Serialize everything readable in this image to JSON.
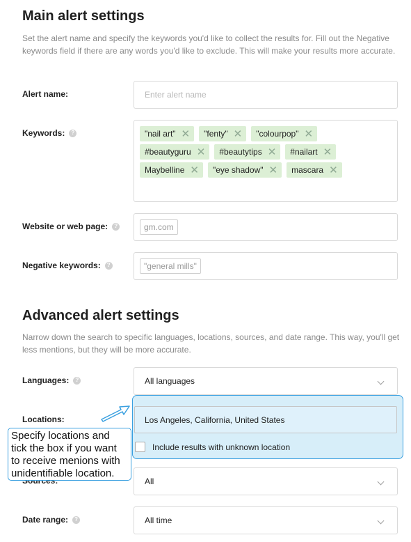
{
  "main": {
    "title": "Main alert settings",
    "description": "Set the alert name and specify the keywords you'd like to collect the results for. Fill out the Negative keywords field if there are any words you'd like to exclude. This will make your results more accurate.",
    "alert_name": {
      "label": "Alert name:",
      "placeholder": "Enter alert name"
    },
    "keywords": {
      "label": "Keywords:",
      "chips": [
        "\"nail art\"",
        "\"fenty\"",
        "\"colourpop\"",
        "#beautyguru",
        "#beautytips",
        "#nailart",
        "Maybelline",
        "\"eye shadow\"",
        "mascara"
      ]
    },
    "website": {
      "label": "Website or web page:",
      "tag": "gm.com"
    },
    "negative": {
      "label": "Negative keywords:",
      "tag": "\"general mills\""
    }
  },
  "advanced": {
    "title": "Advanced alert settings",
    "description": "Narrow down the search to specific languages, locations, sources, and date range. This way, you'll get less mentions, but they will be more accurate.",
    "languages": {
      "label": "Languages:",
      "value": "All languages"
    },
    "locations": {
      "label": "Locations:",
      "value": "Los Angeles, California, United States",
      "checkbox_label": "Include results with unknown location"
    },
    "sources": {
      "label": "Sources:",
      "value": "All"
    },
    "date_range": {
      "label": "Date range:",
      "value": "All time"
    }
  },
  "callout": {
    "text": "Specify locations and tick the box if you want to receive menions with unidentifiable location."
  },
  "icons": {
    "help": "question-circle-icon",
    "remove": "close-icon",
    "dropdown": "chevron-down-icon",
    "pointer": "arrow-icon"
  },
  "colors": {
    "chip_bg": "#dcefd5",
    "highlight_border": "#3aa0e0",
    "highlight_bg": "#d7eef9"
  }
}
